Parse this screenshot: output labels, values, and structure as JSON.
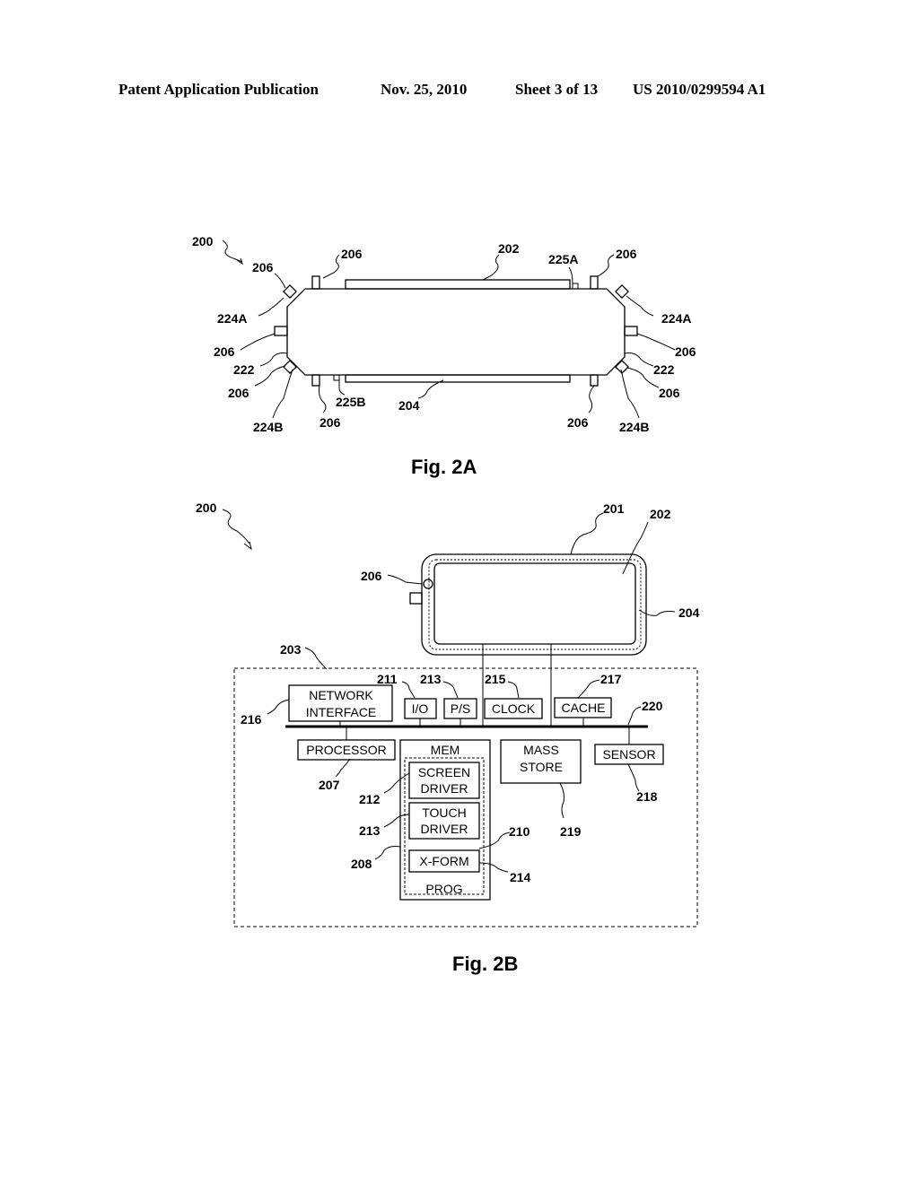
{
  "header": {
    "publication": "Patent Application Publication",
    "date": "Nov. 25, 2010",
    "sheet": "Sheet 3 of 13",
    "number": "US 2010/0299594 A1"
  },
  "fig2a": {
    "caption": "Fig. 2A",
    "labels": {
      "device": "200",
      "top_display": "202",
      "bottom_display": "204",
      "button": "206",
      "corner_a": "224A",
      "corner_b": "224B",
      "edge": "222",
      "gap_a": "225A",
      "gap_b": "225B"
    }
  },
  "fig2b": {
    "caption": "Fig. 2B",
    "labels": {
      "device": "200",
      "housing": "201",
      "display": "202",
      "touch": "204",
      "button": "206",
      "system": "203",
      "io_ref": "211",
      "ps_ref": "213",
      "clock_ref": "215",
      "cache_ref": "217",
      "bus_ref": "220",
      "network_ref": "216",
      "processor_ref": "207",
      "screen_driver_ref": "212",
      "touch_driver_ref": "213",
      "mem_ref": "208",
      "prog_ref": "210",
      "xform_ref": "214",
      "mass_store_ref": "219",
      "sensor_ref": "218"
    },
    "blocks": {
      "network_line1": "NETWORK",
      "network_line2": "INTERFACE",
      "io": "I/O",
      "ps": "P/S",
      "clock": "CLOCK",
      "cache": "CACHE",
      "processor": "PROCESSOR",
      "mem": "MEM",
      "screen_driver_line1": "SCREEN",
      "screen_driver_line2": "DRIVER",
      "touch_driver_line1": "TOUCH",
      "touch_driver_line2": "DRIVER",
      "xform": "X-FORM",
      "prog": "PROG",
      "mass_store_line1": "MASS",
      "mass_store_line2": "STORE",
      "sensor": "SENSOR"
    }
  }
}
